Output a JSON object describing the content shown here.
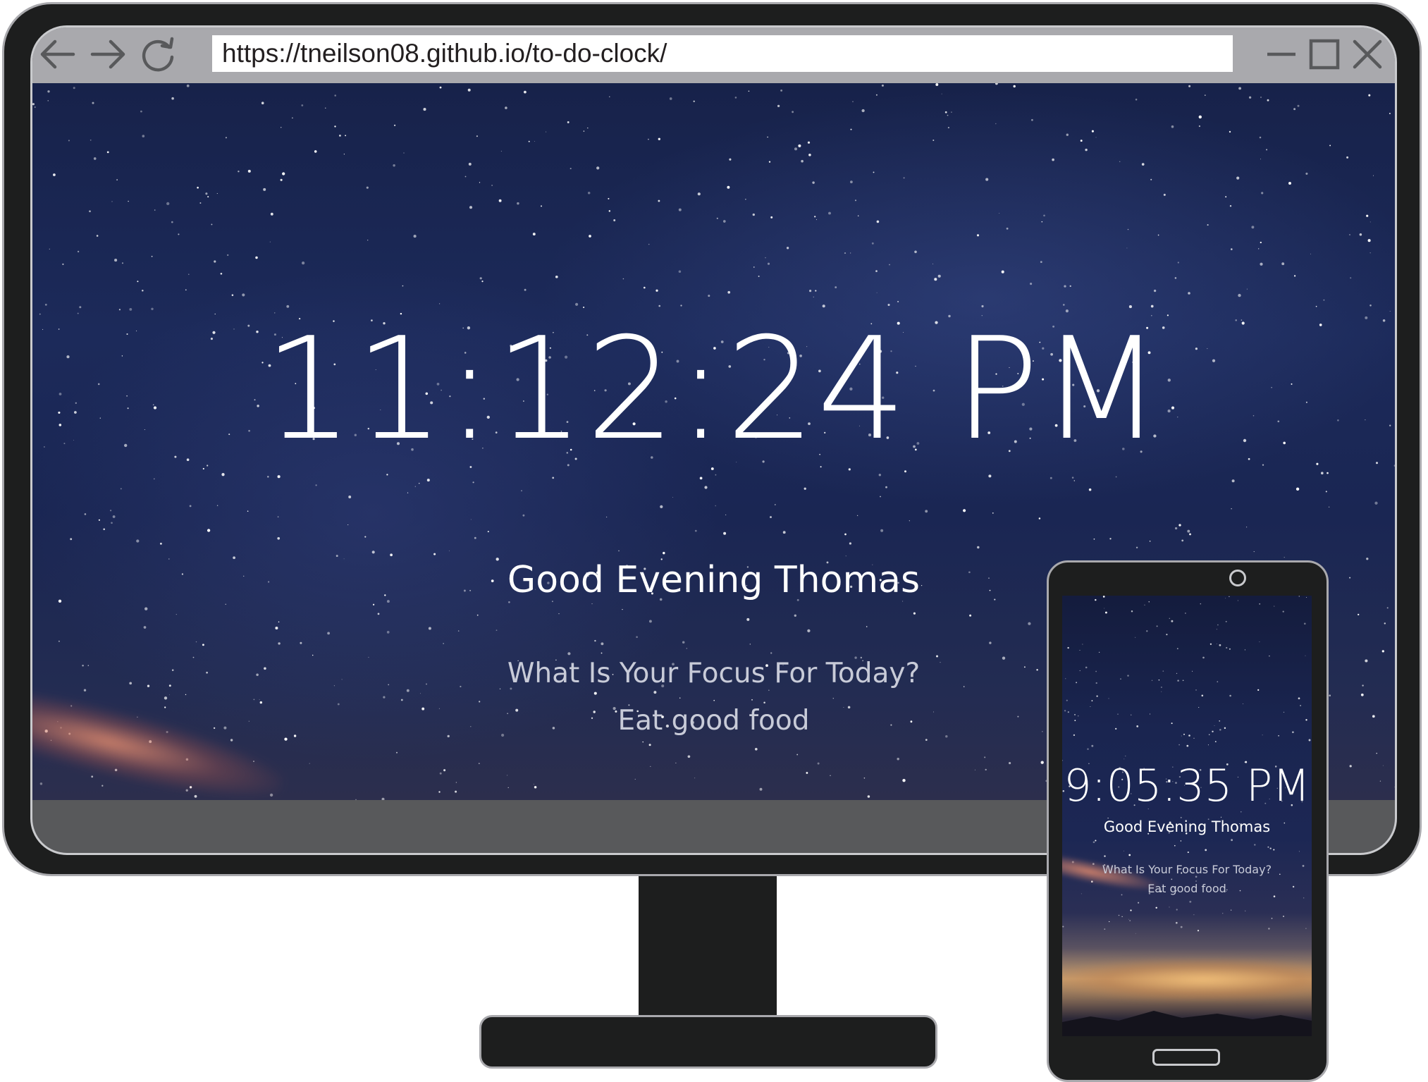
{
  "browser": {
    "url": "https://tneilson08.github.io/to-do-clock/",
    "icons": {
      "back": "arrow-left-icon",
      "forward": "arrow-right-icon",
      "reload": "reload-icon",
      "minimize": "minimize-icon",
      "maximize": "maximize-icon",
      "close": "close-icon"
    }
  },
  "desktop_app": {
    "time": "11:12:24 PM",
    "greeting": "Good Evening Thomas",
    "focus_question": "What Is Your Focus For Today?",
    "focus_answer": "Eat good food"
  },
  "mobile_app": {
    "time": "9:05:35 PM",
    "greeting": "Good Evening Thomas",
    "focus_question": "What Is Your Focus For Today?",
    "focus_answer": "Eat good food"
  },
  "colors": {
    "device_body": "#1d1e1e",
    "device_outline": "#a9a9ad",
    "browser_bar": "#a9a9ad",
    "screen_bottom": "#58595b",
    "text_primary": "#ffffff",
    "text_secondary": "#c8cbd8"
  }
}
